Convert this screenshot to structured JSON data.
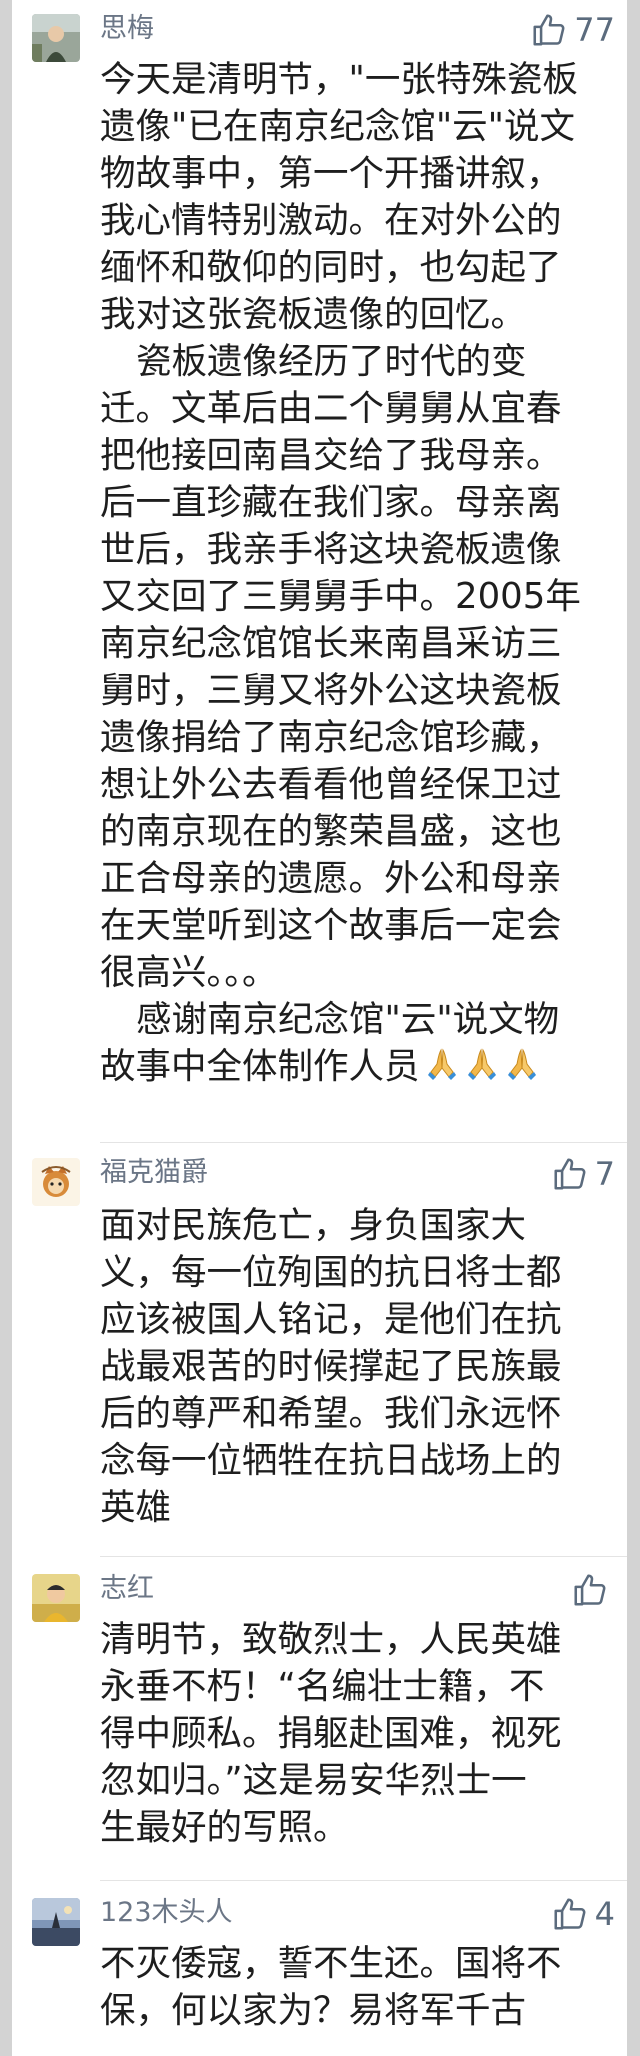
{
  "comments": [
    {
      "username": "思梅",
      "likes": "77",
      "lines": [
        "今天是清明节，\"一张特殊瓷板",
        "遗像\"已在南京纪念馆\"云\"说文",
        "物故事中，第一个开播讲叙，",
        "我心情特别激动。在对外公的",
        "缅怀和敬仰的同时，也勾起了",
        "我对这张瓷板遗像的回忆。",
        "瓷板遗像经历了时代的变",
        "迁。文革后由二个舅舅从宜春",
        "把他接回南昌交给了我母亲。",
        "后一直珍藏在我们家。母亲离",
        "世后，我亲手将这块瓷板遗像",
        "又交回了三舅舅手中。2005年",
        "南京纪念馆馆长来南昌采访三",
        "舅时，三舅又将外公这块瓷板",
        "遗像捐给了南京纪念馆珍藏，",
        "想让外公去看看他曾经保卫过",
        "的南京现在的繁荣昌盛，这也",
        "正合母亲的遗愿。外公和母亲",
        "在天堂听到这个故事后一定会",
        "很高兴。。。",
        "感谢南京纪念馆\"云\"说文物",
        "故事中全体制作人员"
      ]
    },
    {
      "username": "福克猫爵",
      "likes": "7",
      "lines": [
        "面对民族危亡，身负国家大",
        "义，每一位殉国的抗日将士都",
        "应该被国人铭记，是他们在抗",
        "战最艰苦的时候撑起了民族最",
        "后的尊严和希望。我们永远怀",
        "念每一位牺牲在抗日战场上的",
        "英雄"
      ]
    },
    {
      "username": "志红",
      "likes": "",
      "lines": [
        "清明节，致敬烈士，人民英雄",
        "永垂不朽！“名编壮士籍，不",
        "得中顾私。捐躯赴国难，视死",
        "忽如归。”这是易安华烈士一",
        "生最好的写照。"
      ]
    },
    {
      "username": "123木头人",
      "likes": "4",
      "lines": [
        "不灭倭寇，誓不生还。国将不",
        "保，何以家为？易将军千古"
      ]
    }
  ]
}
